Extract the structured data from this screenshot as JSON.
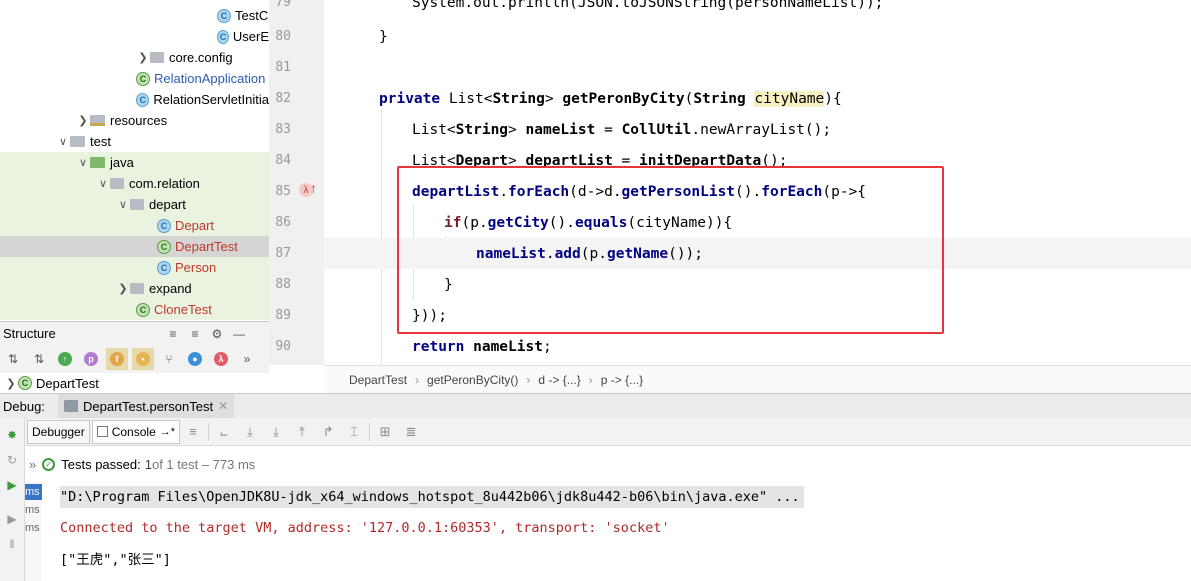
{
  "tree": {
    "items": [
      {
        "label": "TestC",
        "icon": "class-icon",
        "style": "plain"
      },
      {
        "label": "UserE",
        "icon": "class-icon",
        "style": "plain"
      },
      {
        "label": "core.config",
        "icon": "package-icon",
        "style": "plain"
      },
      {
        "label": "RelationApplication",
        "icon": "spring-class-icon",
        "style": "blue"
      },
      {
        "label": "RelationServletInitia",
        "icon": "class-icon",
        "style": "plain"
      },
      {
        "label": "resources",
        "icon": "resources-folder-icon",
        "style": "plain"
      },
      {
        "label": "test",
        "icon": "",
        "style": "plain"
      },
      {
        "label": "java",
        "icon": "test-folder-icon",
        "style": "plain"
      },
      {
        "label": "com.relation",
        "icon": "package-icon",
        "style": "plain"
      },
      {
        "label": "depart",
        "icon": "package-icon",
        "style": "plain"
      },
      {
        "label": "Depart",
        "icon": "class-icon",
        "style": "red"
      },
      {
        "label": "DepartTest",
        "icon": "test-class-icon",
        "style": "red"
      },
      {
        "label": "Person",
        "icon": "class-icon",
        "style": "red"
      },
      {
        "label": "expand",
        "icon": "package-icon",
        "style": "plain"
      },
      {
        "label": "CloneTest",
        "icon": "test-class-icon",
        "style": "red"
      }
    ]
  },
  "structure": {
    "title": "Structure",
    "item": "DepartTest"
  },
  "editor": {
    "line_numbers": [
      "79",
      "80",
      "81",
      "82",
      "83",
      "84",
      "85",
      "86",
      "87",
      "88",
      "89",
      "90"
    ],
    "lines": {
      "l79": "System.out.println(JSON.toJSONString(personNameList));",
      "l80_brace": "}",
      "l82_private": "private ",
      "l82_list": "List",
      "l82_lt": "<",
      "l82_string": "String",
      "l82_gt": "> ",
      "l82_method": "getPeronByCity",
      "l82_open": "(",
      "l82_ptype": "String ",
      "l82_param": "cityName",
      "l82_close": "){",
      "l83_type": "List",
      "l83_lt": "<",
      "l83_string": "String",
      "l83_gt": "> ",
      "l83_var": "nameList",
      "l83_eq": " = ",
      "l83_util": "CollUtil",
      "l83_dot": ".",
      "l83_call": "newArrayList",
      "l83_end": "();",
      "l84_type": "List",
      "l84_lt": "<",
      "l84_depart": "Depart",
      "l84_gt": "> ",
      "l84_var": "departList",
      "l84_eq": " = ",
      "l84_call": "initDepartData",
      "l84_end": "();",
      "l85_var": "departList",
      "l85_dot": ".",
      "l85_foreach": "forEach",
      "l85_lam1": "(d->",
      "l85_d": "d",
      "l85_dot2": ".",
      "l85_getlist": "getPersonList",
      "l85_mid": "().",
      "l85_foreach2": "forEach",
      "l85_lam2": "(p->{",
      "l86_if": "if",
      "l86_open": "(",
      "l86_p": "p",
      "l86_dot": ".",
      "l86_getcity": "getCity",
      "l86_mid": "().",
      "l86_equals": "equals",
      "l86_arg": "(cityName)",
      "l86_end": "){",
      "l87_var": "nameList",
      "l87_dot": ".",
      "l87_add": "add",
      "l87_open": "(",
      "l87_p": "p",
      "l87_dot2": ".",
      "l87_getname": "getName",
      "l87_end": "());",
      "l88_brace": "}",
      "l89_end": "}));",
      "l90_return": "return ",
      "l90_var": "nameList",
      "l90_semi": ";"
    },
    "breadcrumb": [
      "DepartTest",
      "getPeronByCity()",
      "d -> {...}",
      "p -> {...}"
    ]
  },
  "debug": {
    "label": "Debug:",
    "session_tab": "DepartTest.personTest",
    "tabs": [
      "Debugger",
      "Console"
    ],
    "console_tab_suffix": "→*",
    "status": {
      "prefix": "»",
      "passed": "Tests passed:",
      "count": "1",
      "of": " of 1 test – 773 ms"
    },
    "ms_labels": [
      "ms",
      "ms",
      "ms"
    ],
    "console_lines": [
      "\"D:\\Program Files\\OpenJDK8U-jdk_x64_windows_hotspot_8u442b06\\jdk8u442-b06\\bin\\java.exe\" ...",
      "Connected to the target VM, address: '127.0.0.1:60353', transport: 'socket'",
      "[\"王虎\",\"张三\"]"
    ]
  },
  "colors": {
    "keyword": "#000080",
    "field": "#660e7a",
    "highlight_box": "#e8353b",
    "test_green": "#eaf3e0"
  }
}
